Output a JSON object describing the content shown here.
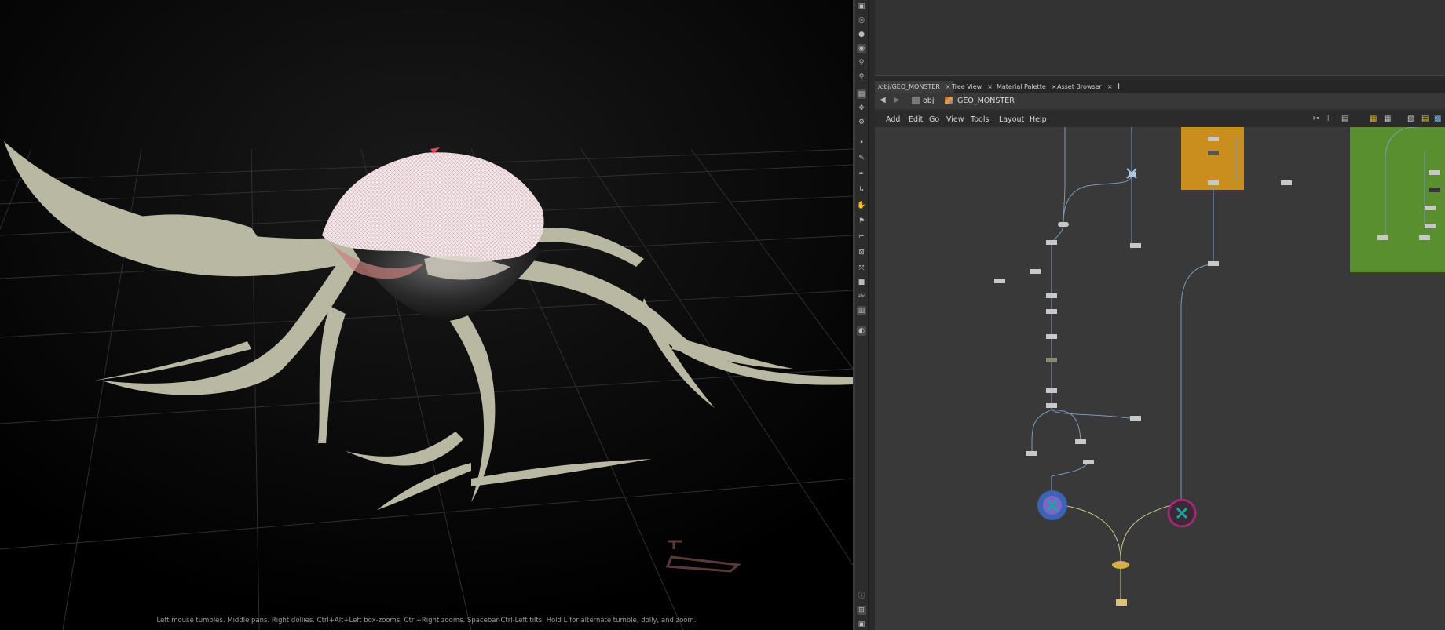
{
  "viewport": {
    "hint": "Left mouse tumbles. Middle pans. Right dollies. Ctrl+Alt+Left box-zooms. Ctrl+Right zooms. Spacebar-Ctrl-Left tilts. Hold L for alternate tumble, dolly, and zoom."
  },
  "network": {
    "tabs": [
      {
        "label": "/obj/GEO_MONSTER"
      },
      {
        "label": "Tree View"
      },
      {
        "label": "Material Palette"
      },
      {
        "label": "Asset Browser"
      }
    ],
    "tab_close": "×",
    "tab_add": "+",
    "path": {
      "root": "obj",
      "current": "GEO_MONSTER"
    },
    "menu": [
      "Add",
      "Edit",
      "Go",
      "View",
      "Tools",
      "Layout",
      "Help"
    ],
    "nav": {
      "back": "◀",
      "forward": "▶"
    }
  },
  "shelf": {
    "icons": [
      "lock-icon",
      "select-icon",
      "sphere-icon",
      "light-icon",
      "bulb-icon",
      "camera-icon",
      "snapshot-icon",
      "transform-icon",
      "handle-icon",
      "display-icon",
      "point-icon",
      "brush-icon",
      "pen-icon",
      "curve-icon",
      "hand-icon",
      "flag-icon",
      "axis-icon",
      "box-icon",
      "node-icon",
      "square-icon",
      "abc-icon",
      "render-icon",
      "info-icon",
      "grid-icon",
      "view-icon"
    ],
    "abc_text": "abc"
  },
  "colors": {
    "network_bg": "#393939",
    "wire": "#7c9ab9",
    "wire_alt": "#c9c78f",
    "orange_box": "#c98e1d",
    "green_box": "#5a8f2f",
    "blue_node": "#3d63b5",
    "magenta_node": "#a12a76",
    "teal_node": "#19a8a0",
    "gold_node": "#d4b04a",
    "mesh": "#b9b8a2"
  }
}
